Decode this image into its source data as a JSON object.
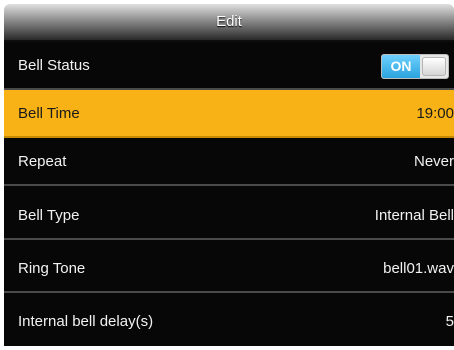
{
  "header": {
    "title": "Edit"
  },
  "rows": [
    {
      "label": "Bell Status",
      "toggle_text": "ON",
      "toggle_state": "on"
    },
    {
      "label": "Bell Time",
      "value": "19:00",
      "selected": true
    },
    {
      "label": "Repeat",
      "value": "Never"
    },
    {
      "label": "Bell Type",
      "value": "Internal Bell"
    },
    {
      "label": "Ring Tone",
      "value": "bell01.wav"
    },
    {
      "label": "Internal bell delay(s)",
      "value": "5"
    }
  ],
  "colors": {
    "selected_row": "#f8b215",
    "list_background": "#070707",
    "toggle_on": "#2aa4dc"
  }
}
